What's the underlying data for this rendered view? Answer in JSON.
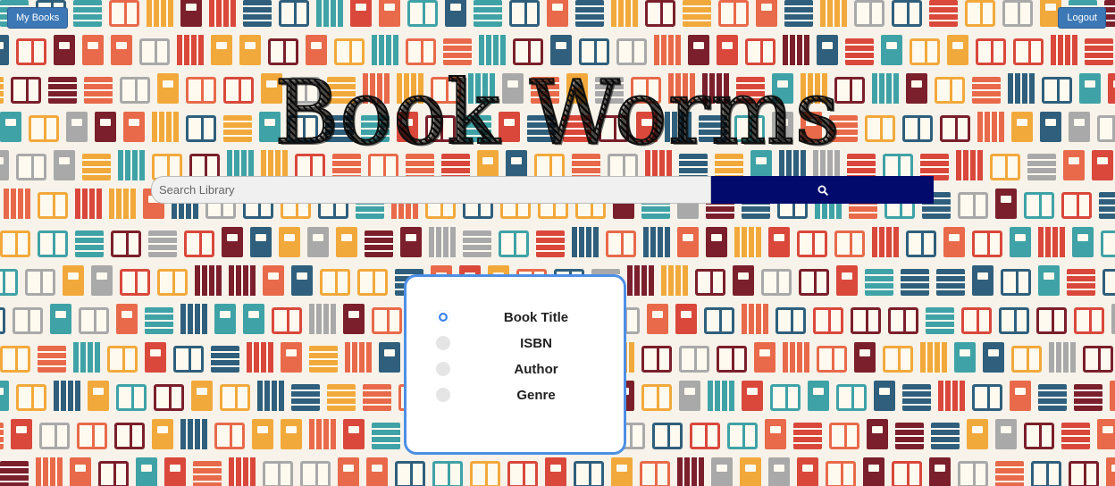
{
  "header": {
    "my_books_label": "My Books",
    "logout_label": "Logout"
  },
  "logo": {
    "text": "Book Worms"
  },
  "search": {
    "placeholder": "Search Library",
    "value": "",
    "button_icon": "search-icon"
  },
  "filters": {
    "options": [
      {
        "label": "Book Title",
        "checked": true
      },
      {
        "label": "ISBN",
        "checked": false
      },
      {
        "label": "Author",
        "checked": false
      },
      {
        "label": "Genre",
        "checked": false
      }
    ]
  },
  "colors": {
    "button_blue": "#3d78b6",
    "search_button": "#020a6b",
    "filter_border": "#4d8fe6",
    "radio_checked": "#3b82e8"
  }
}
